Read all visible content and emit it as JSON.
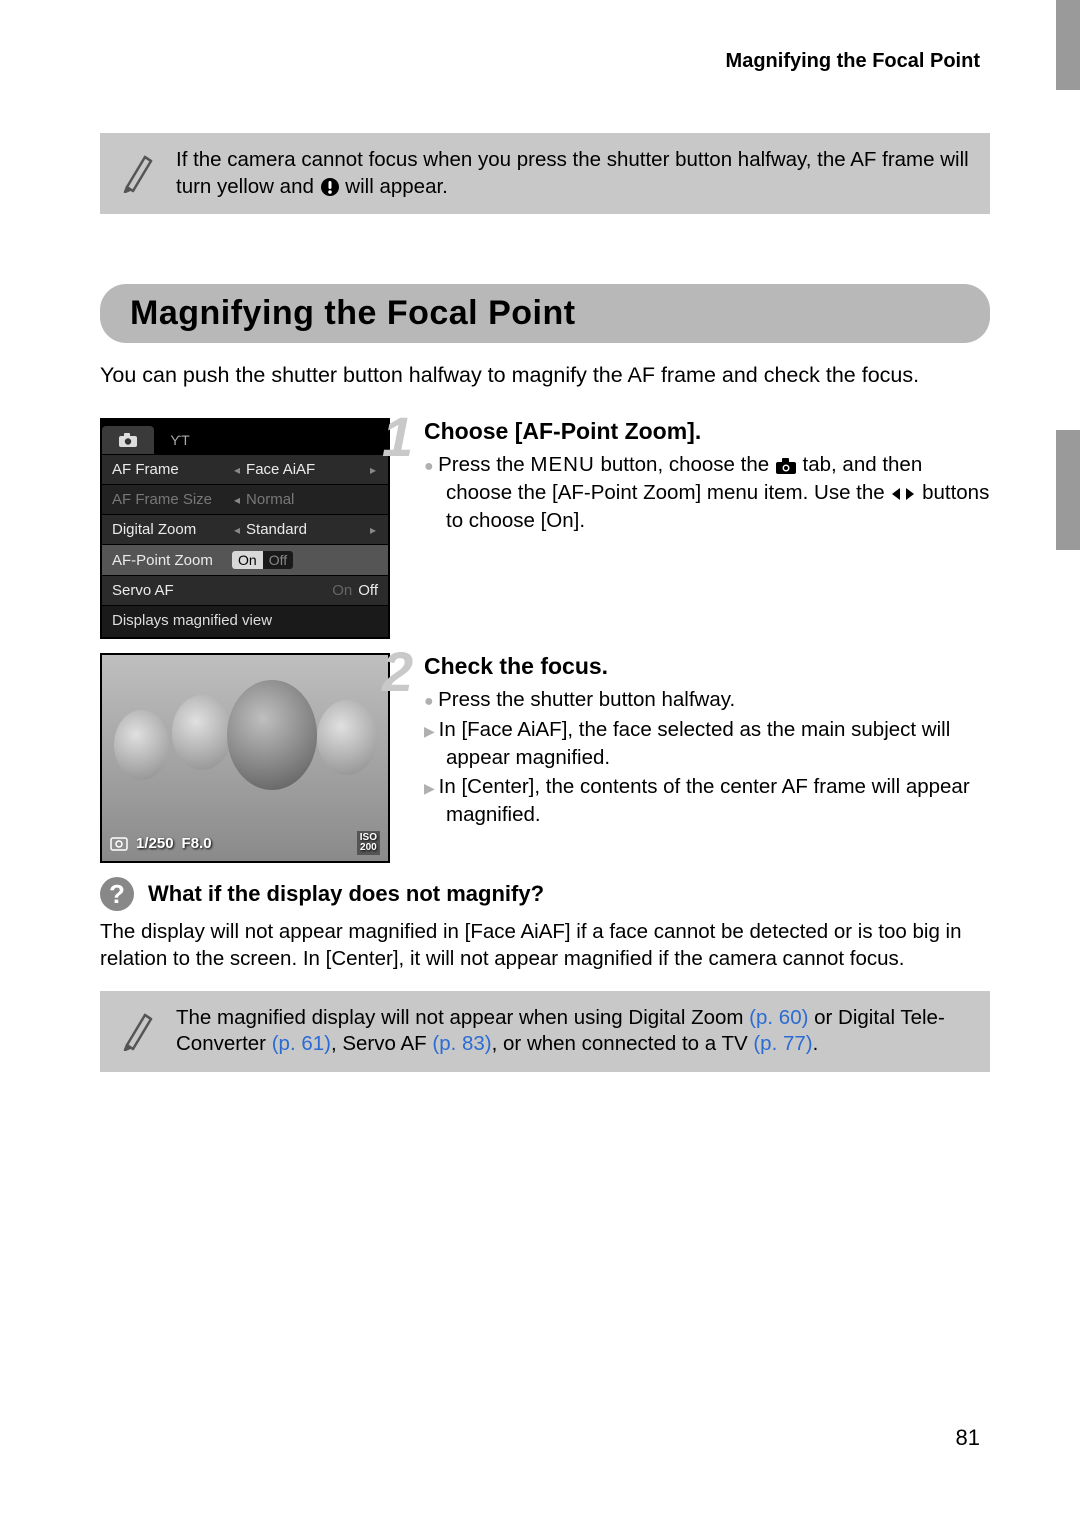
{
  "running_header": "Magnifying the Focal Point",
  "top_note": {
    "part1": "If the camera cannot focus when you press the shutter button halfway, the AF frame will turn yellow and ",
    "part2": " will appear."
  },
  "section_title": "Magnifying the Focal Point",
  "intro": "You can push the shutter button halfway to magnify the AF frame and check the focus.",
  "menu": {
    "rows": [
      {
        "label": "AF Frame",
        "value": "Face AiAF"
      },
      {
        "label": "AF Frame Size",
        "value": "Normal"
      },
      {
        "label": "Digital Zoom",
        "value": "Standard"
      },
      {
        "label": "AF-Point Zoom",
        "on": "On",
        "off": "Off"
      },
      {
        "label": "Servo AF",
        "on": "On",
        "off": "Off"
      }
    ],
    "footer": "Displays magnified view"
  },
  "photo": {
    "shutter": "1/250",
    "aperture": "F8.0",
    "iso_label": "ISO",
    "iso_value": "200"
  },
  "step1": {
    "num": "1",
    "title": "Choose [AF-Point Zoom].",
    "b1a": "Press the ",
    "menu_label": "MENU",
    "b1b": " button, choose the ",
    "b1c": " tab, and then choose the [AF-Point Zoom] menu item. Use the ",
    "b1d": " buttons to choose [On]."
  },
  "step2": {
    "num": "2",
    "title": "Check the focus.",
    "b1": "Press the shutter button halfway.",
    "b2": "In [Face AiAF], the face selected as the main subject will appear magnified.",
    "b3": "In [Center], the contents of the center AF frame will appear magnified."
  },
  "question": {
    "title": "What if the display does not magnify?",
    "body": "The display will not appear magnified in [Face AiAF] if a face cannot be detected or is too big in relation to the screen. In [Center], it will not appear magnified if the camera cannot focus."
  },
  "bottom_note": {
    "t1": "The magnified display will not appear when using Digital Zoom ",
    "p1": "(p. 60)",
    "t2": " or Digital Tele-Converter ",
    "p2": "(p. 61)",
    "t3": ", Servo AF ",
    "p3": "(p. 83)",
    "t4": ", or when connected to a TV ",
    "p4": "(p. 77)",
    "t5": "."
  },
  "page_number": "81"
}
